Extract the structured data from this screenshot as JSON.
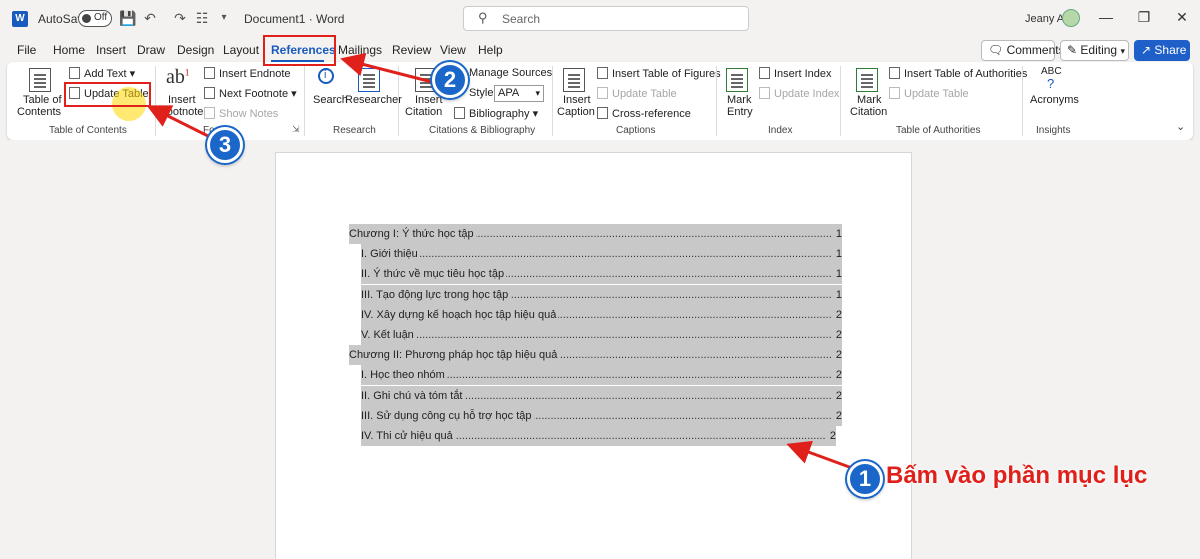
{
  "titlebar": {
    "logo": "W",
    "autosave_label": "AutoSave",
    "autosave_state": "Off",
    "doc_title": "Document1 · Word",
    "search_placeholder": "Search",
    "user_name": "Jeany A",
    "icons": [
      "save-icon",
      "undo-icon",
      "redo-icon",
      "customize-icon"
    ]
  },
  "menu": {
    "tabs": [
      "File",
      "Home",
      "Insert",
      "Draw",
      "Design",
      "Layout",
      "References",
      "Mailings",
      "Review",
      "View",
      "Help"
    ],
    "active_tab": "References",
    "comments_label": "Comments",
    "editing_label": "Editing",
    "share_label": "Share"
  },
  "ribbon": {
    "toc": {
      "big_label_1": "Table of",
      "big_label_2": "Contents",
      "add_text": "Add Text",
      "update_table": "Update Table",
      "group": "Table of Contents"
    },
    "footnotes": {
      "insert_footnote_1": "Insert",
      "insert_footnote_2": "Footnote",
      "insert_endnote": "Insert Endnote",
      "next_footnote": "Next Footnote",
      "show_notes": "Show Notes",
      "group": "Fo"
    },
    "research": {
      "search": "Search",
      "researcher": "Researcher",
      "group": "Research"
    },
    "citations": {
      "insert_citation_1": "Insert",
      "insert_citation_2": "Citation",
      "manage_sources": "Manage Sources",
      "style_label": "Style:",
      "style_value": "APA",
      "bibliography": "Bibliography",
      "group": "Citations & Bibliography"
    },
    "captions": {
      "insert_caption_1": "Insert",
      "insert_caption_2": "Caption",
      "insert_table_of_figures": "Insert Table of Figures",
      "update_table": "Update Table",
      "cross_reference": "Cross-reference",
      "group": "Captions"
    },
    "index": {
      "mark_entry_1": "Mark",
      "mark_entry_2": "Entry",
      "insert_index": "Insert Index",
      "update_index": "Update Index",
      "group": "Index"
    },
    "authorities": {
      "mark_citation_1": "Mark",
      "mark_citation_2": "Citation",
      "insert_toa": "Insert Table of Authorities",
      "update_table": "Update Table",
      "group": "Table of Authorities"
    },
    "insights": {
      "abc": "ABC",
      "question": "?",
      "acronyms": "Acronyms",
      "group": "Insights"
    }
  },
  "toc_entries": [
    {
      "text": "Chương I: Ý thức học tập",
      "page": "1",
      "level": 1
    },
    {
      "text": "I. Giới thiệu",
      "page": "1",
      "level": 2
    },
    {
      "text": "II. Ý thức về mục tiêu học tập",
      "page": "1",
      "level": 2
    },
    {
      "text": "III. Tạo động lực trong học tập",
      "page": "1",
      "level": 2
    },
    {
      "text": "IV. Xây dựng kế hoạch học tập hiệu quả",
      "page": "2",
      "level": 2
    },
    {
      "text": "V. Kết luận",
      "page": "2",
      "level": 2
    },
    {
      "text": "Chương II: Phương pháp học tập hiệu quả",
      "page": "2",
      "level": 1
    },
    {
      "text": "I. Học theo nhóm",
      "page": "2",
      "level": 2
    },
    {
      "text": "II. Ghi chú và tóm tắt",
      "page": "2",
      "level": 2
    },
    {
      "text": "III. Sử dụng công cụ hỗ trợ học tập",
      "page": "2",
      "level": 2
    },
    {
      "text": "IV. Thi cử hiệu quả",
      "page": "2",
      "level": 2
    }
  ],
  "annotations": {
    "step1": "1",
    "step2": "2",
    "step3": "3",
    "callout": "Bấm vào phần mục lục",
    "color": "#e0201a",
    "badge_color": "#1b66c9"
  }
}
